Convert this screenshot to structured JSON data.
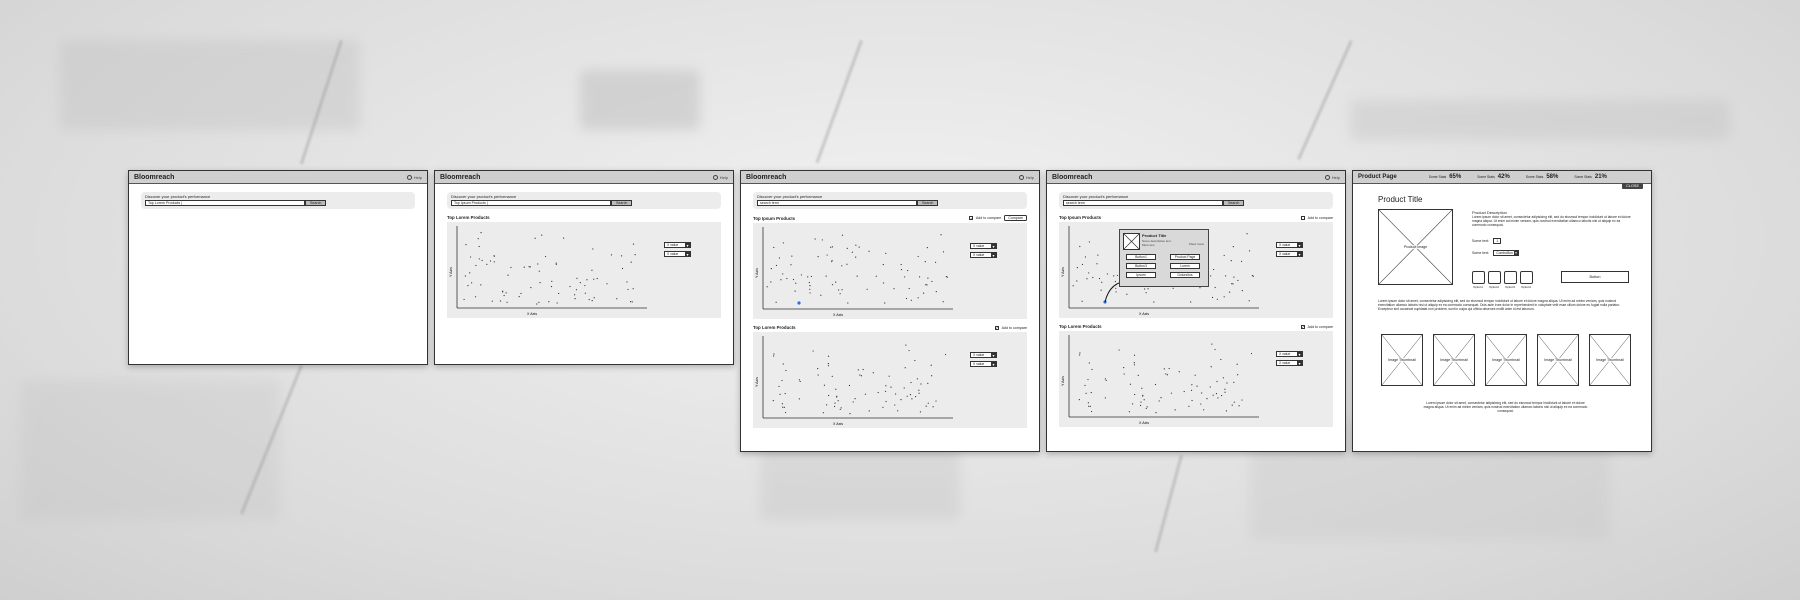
{
  "app_title": "Bloomreach",
  "help_label": "Help",
  "discover_label": "Discover your product's performance",
  "search_button": "Search",
  "search_values": [
    "Top Lorem Products |",
    "Top Ipsum Products |",
    "search term",
    "search term"
  ],
  "section_titles": {
    "lorem": "Top Lorem Products",
    "ipsum": "Top Ipsum Products"
  },
  "add_to_compare": "Add to compare",
  "compare_button": "Compare",
  "axis": {
    "x": "X Axis",
    "y": "Y Axis"
  },
  "dropdown_value": "X value",
  "popup": {
    "title": "Product Title",
    "subtitle": "Some descriptive text",
    "subtitle2": "More text",
    "more": "Show more",
    "buttons": [
      "Button1",
      "Product Page",
      "Button3",
      "Lorem",
      "Ipsum",
      "Dolorsitus"
    ]
  },
  "product_page": {
    "header_title": "Product Page",
    "scores": [
      {
        "label": "Some Stats",
        "value": "65%"
      },
      {
        "label": "Some Stats",
        "value": "42%"
      },
      {
        "label": "Some Stats",
        "value": "58%"
      },
      {
        "label": "Some Stats",
        "value": "21%"
      }
    ],
    "close": "CLOSE",
    "title": "Product Title",
    "image_label": "Product Image",
    "description_heading": "Product Description",
    "description": "Lorem ipsum dolor sit amet, consectetur adipisicing elit, sed do eiusmod tempor incididunt ut labore et dolore magna aliqua. Ut enim ad minim veniam, quis nostrud exercitation ullamco laboris nisi ut aliquip ex ea commodo consequat.",
    "some_text_1": "Some text:",
    "stepper_value": "1",
    "some_text_2": "Some text:",
    "combo_value": "ComboBox",
    "options": [
      "Option1",
      "Option2",
      "Option3",
      "Option4"
    ],
    "button_label": "Button",
    "mid_text": "Lorem ipsum dolor sit amet, consectetur adipisicing elit, sed do eiusmod tempor incididunt ut labore et dolore magna aliqua. Ut enim ad minim veniam, quis nostrud exercitation ullamco laboris nisi ut aliquip ex ea commodo consequat. Duis aute irure dolor in reprehenderit in voluptate velit esse cillum dolore eu fugiat nulla pariatur. Excepteur sint occaecat cupidatat non proident, sunt in culpa qui officia deserunt mollit anim id est laborum.",
    "thumbnail_label": "Image Thumbnail",
    "bottom_text": "Lorem ipsum dolor sit amet, consectetur adipisicing elit, sed do eiusmod tempor incididunt ut labore et dolore magna aliqua. Ut enim ad minim veniam, quis nostrud exercitation ullamco laboris nisi ut aliquip ex ea commodo consequat."
  }
}
